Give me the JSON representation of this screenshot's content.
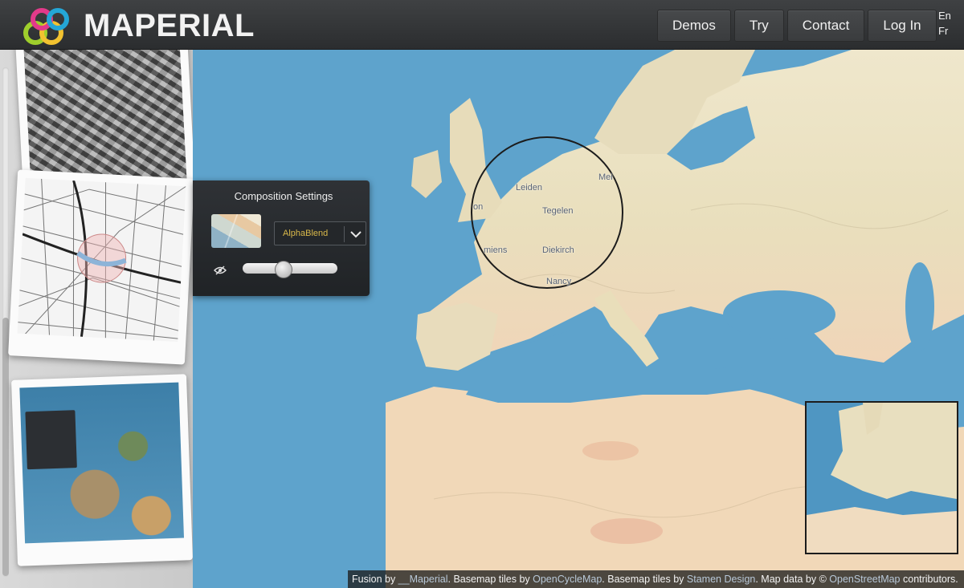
{
  "header": {
    "brand": "MAPERIAL",
    "nav": [
      {
        "label": "Demos"
      },
      {
        "label": "Try"
      },
      {
        "label": "Contact"
      },
      {
        "label": "Log In"
      }
    ],
    "languages": [
      "En",
      "Fr"
    ]
  },
  "composition_settings": {
    "title": "Composition Settings",
    "blend_mode": "AlphaBlend",
    "opacity_fraction": 0.4
  },
  "map": {
    "places": [
      "Leiden",
      "Tegelen",
      "Diekirch",
      "Nancy",
      "miens",
      "on",
      "Mei"
    ]
  },
  "attribution": {
    "fusion_prefix": "Fusion by ",
    "fusion_link": "__Maperial",
    "basemap1_prefix": ". Basemap tiles by ",
    "basemap1_link": "OpenCycleMap",
    "basemap2_prefix": ". Basemap tiles by ",
    "basemap2_link": "Stamen Design",
    "mapdata_prefix": ". Map data by © ",
    "mapdata_link": "OpenStreetMap",
    "suffix": " contributors."
  },
  "colors": {
    "header_bg": "#323436",
    "sea": "#5ea3cc",
    "land": "#ece2c4",
    "accent_select": "#d9b84a"
  },
  "icons": {
    "logo": "maperial-rings-logo",
    "dropdown": "chevron-down-icon",
    "visibility": "eye-slash-icon"
  }
}
